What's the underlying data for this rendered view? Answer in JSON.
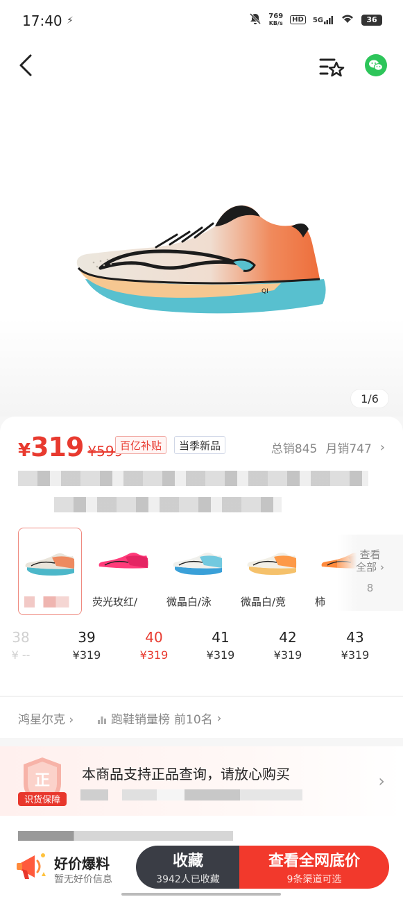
{
  "status_bar": {
    "time": "17:40",
    "net_speed_value": "769",
    "net_speed_unit": "KB/s",
    "hd_label": "HD",
    "signal_label": "5G",
    "battery": "36"
  },
  "top_bar": {
    "icons": [
      "back-arrow-icon",
      "favorites-list-icon",
      "wechat-icon"
    ]
  },
  "gallery": {
    "counter": "1/6"
  },
  "product": {
    "currency": "¥",
    "price": "319",
    "original_price": "¥599",
    "tags": [
      "百亿补贴",
      "当季新品"
    ],
    "total_sales": "总销845",
    "monthly_sales": "月销747"
  },
  "variants": [
    {
      "label": "",
      "selected": true,
      "colors": [
        "#e9e4da",
        "#ef7a4a",
        "#4cb7c9"
      ]
    },
    {
      "label": "荧光玫红/",
      "selected": false,
      "colors": [
        "#ff3b7a",
        "#e0215f",
        "#ffffff"
      ]
    },
    {
      "label": "微晶白/泳",
      "selected": false,
      "colors": [
        "#f0f0ec",
        "#5cc2dd",
        "#3aa0d8"
      ]
    },
    {
      "label": "微晶白/竞",
      "selected": false,
      "colors": [
        "#f2efe6",
        "#ff8a2b",
        "#f5c16b"
      ]
    },
    {
      "label": "柿",
      "selected": false,
      "colors": [
        "#ff8a3c",
        "#e06720",
        "#ffffff"
      ]
    }
  ],
  "see_all": {
    "line1": "查看",
    "line2": "全部",
    "count": "8"
  },
  "sizes": [
    {
      "size": "38",
      "price": "¥ --",
      "state": "disabled"
    },
    {
      "size": "39",
      "price": "¥319",
      "state": "normal"
    },
    {
      "size": "40",
      "price": "¥319",
      "state": "active"
    },
    {
      "size": "41",
      "price": "¥319",
      "state": "normal"
    },
    {
      "size": "42",
      "price": "¥319",
      "state": "normal"
    },
    {
      "size": "43",
      "price": "¥319",
      "state": "normal"
    }
  ],
  "shop_row": {
    "brand": "鸿星尔克",
    "ranking_label": "跑鞋销量榜",
    "ranking_value": "前10名"
  },
  "guarantee": {
    "badge_char": "正",
    "badge_label": "识货保障",
    "title": "本商品支持正品查询，请放心购买"
  },
  "bottom_bar": {
    "deal_title": "好价爆料",
    "deal_sub": "暂无好价信息",
    "collect_label": "收藏",
    "collect_count": "3942人已收藏",
    "price_label": "查看全网底价",
    "price_sub": "9条渠道可选"
  },
  "colors": {
    "accent_red": "#e83a2f",
    "button_red": "#f2392c",
    "button_dark": "#3a3d45",
    "wechat_green": "#2dc55a"
  }
}
